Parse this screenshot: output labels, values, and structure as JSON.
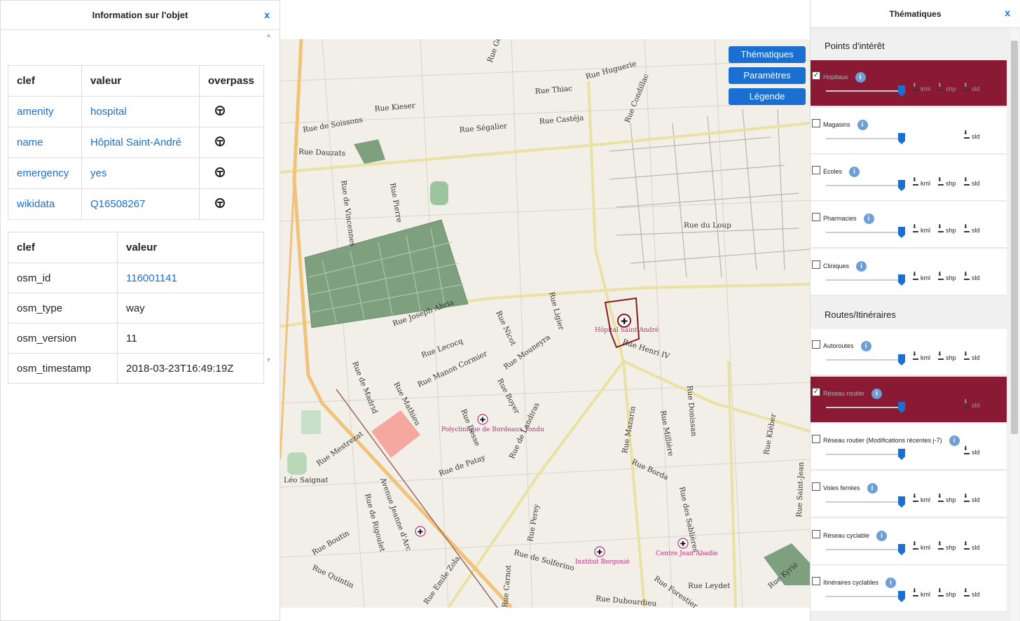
{
  "info_panel": {
    "title": "Information sur l'objet",
    "close": "x",
    "tags_table": {
      "headers": [
        "clef",
        "valeur",
        "overpass"
      ],
      "rows": [
        {
          "key": "amenity",
          "value": "hospital"
        },
        {
          "key": "name",
          "value": "Hôpital Saint-André"
        },
        {
          "key": "emergency",
          "value": "yes"
        },
        {
          "key": "wikidata",
          "value": "Q16508267"
        }
      ],
      "overpass_icon": "steering-wheel-icon"
    },
    "meta_table": {
      "headers": [
        "clef",
        "valeur"
      ],
      "rows": [
        {
          "key": "osm_id",
          "value": "116001141"
        },
        {
          "key": "osm_type",
          "value": "way"
        },
        {
          "key": "osm_version",
          "value": "11"
        },
        {
          "key": "osm_timestamp",
          "value": "2018-03-23T16:49:19Z"
        }
      ]
    }
  },
  "map": {
    "buttons": [
      "Thématiques",
      "Paramètres",
      "Légende"
    ],
    "streets": [
      "Rue Huguerie",
      "Rue Thiac",
      "Rue Kieser",
      "Rue de Soissons",
      "Rue Ségalier",
      "Rue Castéja",
      "Rue Condillac",
      "Rue Dauzats",
      "Rue de Vincennes",
      "Rue Pierre",
      "Rue du Loup",
      "Rue Joseph Abria",
      "Rue Ligier",
      "Rue Nicot",
      "Rue Lecocq",
      "Rue Manon Cormier",
      "Rue Mouneyra",
      "Rue Henri IV",
      "Rue de Madrid",
      "Rue Mathieu",
      "Rue Boyer",
      "Rue Desse",
      "Rue de Landiras",
      "Rue Mestrezat",
      "Rue de Patay",
      "Léo Saignat",
      "Avenue Jeanne d'Arc",
      "Rue de Rigoulet",
      "Rue Boutin",
      "Rue Quintin",
      "Rue Emile Zola",
      "Rue Carnot",
      "Rue Perey",
      "Rue de Solferino",
      "Rue Mazarin",
      "Rue Millière",
      "Rue Donissan",
      "Rue Borda",
      "Rue des Sablières",
      "Rue Kléber",
      "Rue Saint-Jean",
      "Rue Leydet",
      "Rue Dubourdieu",
      "Rue Forestier",
      "Rue Kyrié",
      "Rue Goy"
    ],
    "pois": [
      "Hôpital Saint-André",
      "Polyclinique de Bordeaux Tondu",
      "Institut Bergonié",
      "Centre Jean Abadie"
    ],
    "colors": {
      "hospital_outline": "#8a1a1a",
      "poi_text": "#c0307a",
      "park": "#7fa07f"
    }
  },
  "theme_panel": {
    "title": "Thématiques",
    "close": "x",
    "groups": [
      {
        "title": "Points d'intérêt",
        "items": [
          {
            "name": "Hopitaux",
            "checked": true,
            "downloads": [
              "kml",
              "shp",
              "sld"
            ]
          },
          {
            "name": "Magasins",
            "checked": false,
            "downloads": [
              "sld"
            ]
          },
          {
            "name": "Ecoles",
            "checked": false,
            "downloads": [
              "kml",
              "shp",
              "sld"
            ]
          },
          {
            "name": "Pharmacies",
            "checked": false,
            "downloads": [
              "kml",
              "shp",
              "sld"
            ]
          },
          {
            "name": "Cliniques",
            "checked": false,
            "downloads": [
              "kml",
              "shp",
              "sld"
            ]
          }
        ]
      },
      {
        "title": "Routes/Itinéraires",
        "items": [
          {
            "name": "Autoroutes",
            "checked": false,
            "downloads": [
              "kml",
              "shp",
              "sld"
            ]
          },
          {
            "name": "Réseau routier",
            "checked": true,
            "downloads": [
              "sld"
            ]
          },
          {
            "name": "Réseau routier (Modifications récentes j-7)",
            "checked": false,
            "downloads": [
              "sld"
            ]
          },
          {
            "name": "Voies ferrées",
            "checked": false,
            "downloads": [
              "kml",
              "shp",
              "sld"
            ]
          },
          {
            "name": "Réseau cyclable",
            "checked": false,
            "downloads": [
              "kml",
              "shp",
              "sld"
            ]
          },
          {
            "name": "Itinéraires cyclables",
            "checked": false,
            "downloads": [
              "kml",
              "shp",
              "sld"
            ]
          }
        ]
      }
    ],
    "active_color": "#8a1a33",
    "info_icon": "info-icon",
    "download_icon": "download-icon"
  }
}
